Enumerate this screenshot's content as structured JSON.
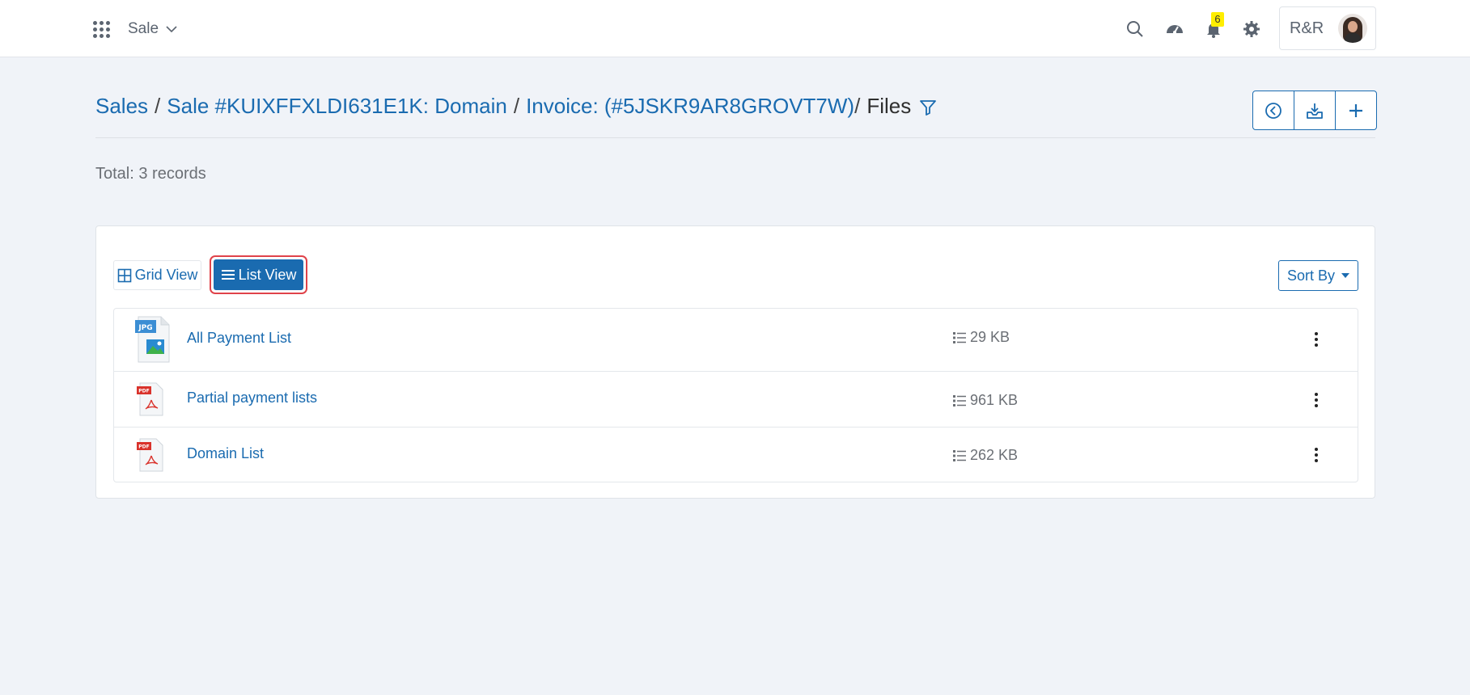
{
  "topbar": {
    "module": "Sale",
    "notification_count": "6",
    "user_initials": "R&R",
    "icons": [
      "apps-grid-icon",
      "search-icon",
      "dashboard-gauge-icon",
      "bell-icon",
      "gear-icon"
    ]
  },
  "breadcrumb": {
    "items": [
      "Sales",
      "Sale #KUIXFFXLDI631E1K: Domain",
      "Invoice: (#5JSKR9AR8GROVT7W)"
    ],
    "current": "Files",
    "separator": "/"
  },
  "actions": {
    "icons": [
      "back-circle-icon",
      "download-tray-icon",
      "plus-icon"
    ]
  },
  "summary": {
    "total": "Total: 3 records"
  },
  "view_toggle": {
    "grid_label": "Grid View",
    "list_label": "List View",
    "active": "list"
  },
  "sort": {
    "label": "Sort By"
  },
  "files": [
    {
      "name": "All Payment List",
      "size": "29 KB",
      "type": "JPG"
    },
    {
      "name": "Partial payment lists",
      "size": "961 KB",
      "type": "PDF"
    },
    {
      "name": "Domain List",
      "size": "262 KB",
      "type": "PDF"
    }
  ],
  "colors": {
    "accent": "#1a6bb0",
    "highlight_border": "#e0434a",
    "badge": "#ffee00",
    "background": "#f0f3f8"
  }
}
